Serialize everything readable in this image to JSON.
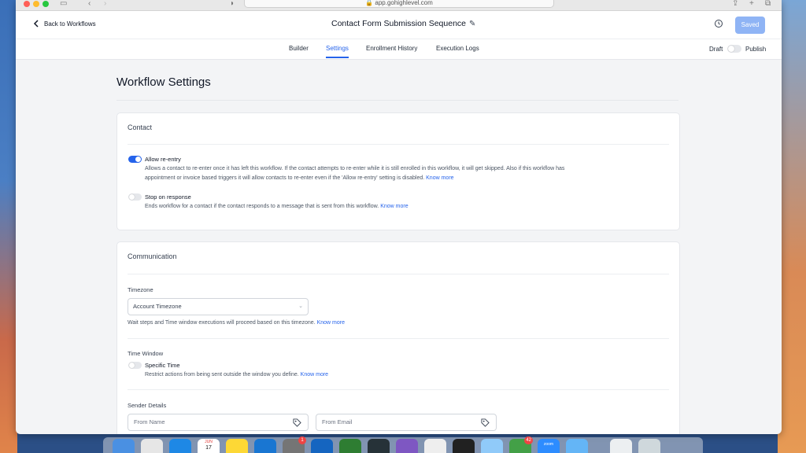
{
  "browser": {
    "url": "app.gohighlevel.com"
  },
  "header": {
    "back_label": "Back to Workflows",
    "workflow_title": "Contact Form Submission Sequence",
    "saved_label": "Saved"
  },
  "tabs": [
    {
      "label": "Builder",
      "active": false
    },
    {
      "label": "Settings",
      "active": true
    },
    {
      "label": "Enrollment History",
      "active": false
    },
    {
      "label": "Execution Logs",
      "active": false
    }
  ],
  "status": {
    "draft_label": "Draft",
    "publish_label": "Publish",
    "published": false
  },
  "page": {
    "title": "Workflow Settings"
  },
  "contact_card": {
    "title": "Contact",
    "allow_reentry": {
      "label": "Allow re-entry",
      "enabled": true,
      "desc_line1": "Allows a contact to re-enter once it has left this workflow. If the contact attempts to re-enter while it is still enrolled in this workflow, it will get skipped. Also if this workflow has",
      "desc_line2": "appointment or invoice based triggers it will allow contacts to re-enter even if the 'Allow re-entry' setting is disabled.",
      "link": "Know more"
    },
    "stop_on_response": {
      "label": "Stop on response",
      "enabled": false,
      "desc": "Ends workflow for a contact if the contact responds to a message that is sent from this workflow.",
      "link": "Know more"
    }
  },
  "communication_card": {
    "title": "Communication",
    "timezone": {
      "label": "Timezone",
      "value": "Account Timezone",
      "help": "Wait steps and Time window executions will proceed based on this timezone.",
      "link": "Know more"
    },
    "time_window": {
      "label": "Time Window",
      "option_label": "Specific Time",
      "enabled": false,
      "desc": "Restrict actions from being sent outside the window you define.",
      "link": "Know more"
    },
    "sender": {
      "label": "Sender Details",
      "from_name_placeholder": "From Name",
      "from_email_placeholder": "From Email"
    }
  },
  "dock": {
    "calendar_month": "JUN",
    "calendar_day": "17",
    "badges": [
      "1",
      "42"
    ],
    "zoom_label": "zoom"
  },
  "colors": {
    "accent": "#2563eb",
    "saved_button": "#8fb4f5",
    "toggle_off": "#e5e7eb"
  }
}
